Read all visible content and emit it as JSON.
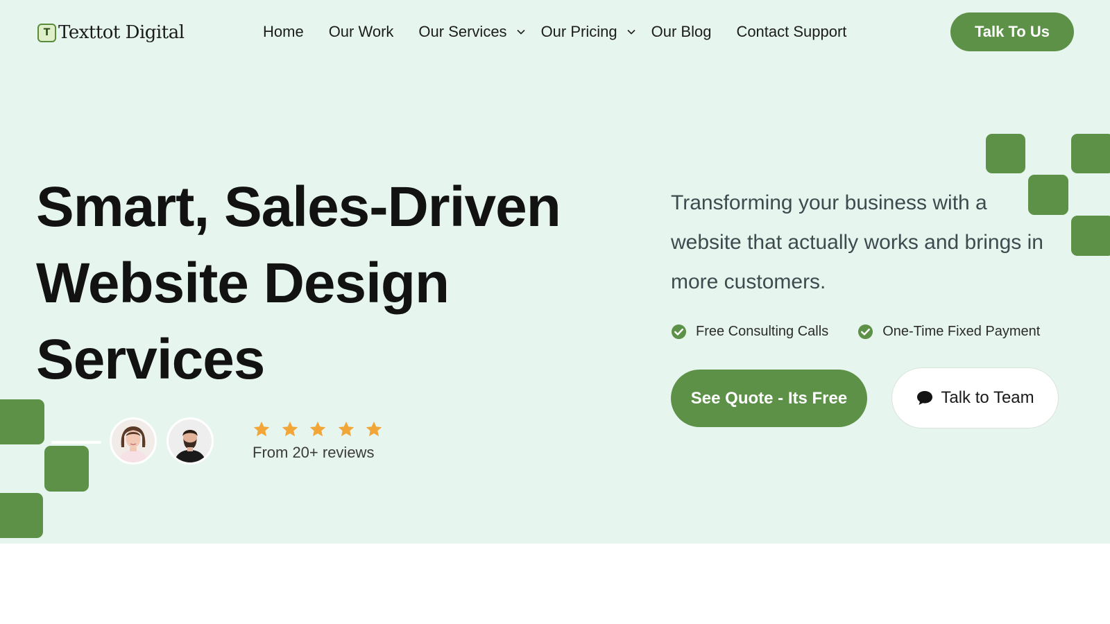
{
  "brand": {
    "logo_letter": "T",
    "name": "Texttot Digital"
  },
  "nav": {
    "items": [
      {
        "label": "Home",
        "has_dropdown": false
      },
      {
        "label": "Our Work",
        "has_dropdown": false
      },
      {
        "label": "Our Services",
        "has_dropdown": true
      },
      {
        "label": "Our Pricing",
        "has_dropdown": true
      },
      {
        "label": "Our Blog",
        "has_dropdown": false
      },
      {
        "label": "Contact Support",
        "has_dropdown": false
      }
    ],
    "cta_label": "Talk To Us"
  },
  "hero": {
    "headline_lines": [
      "Smart, Sales-Driven",
      "Website Design",
      "Services"
    ],
    "description": "Transforming your business with a website that actually works and brings in more customers.",
    "features": [
      {
        "label": "Free Consulting Calls",
        "icon": "check-circle-icon"
      },
      {
        "label": "One-Time Fixed Payment",
        "icon": "check-circle-icon"
      }
    ],
    "primary_cta": "See Quote - Its Free",
    "secondary_cta": "Talk to Team",
    "secondary_cta_icon": "chat-bubble-icon",
    "rating": {
      "stars": 5,
      "max": 5
    },
    "reviews_text": "From 20+ reviews",
    "avatars": [
      "woman-avatar",
      "man-avatar"
    ]
  },
  "colors": {
    "accent": "#5d9147",
    "hero_background": "#e6f6ee",
    "star": "#f2a637",
    "text_dark": "#121212"
  }
}
